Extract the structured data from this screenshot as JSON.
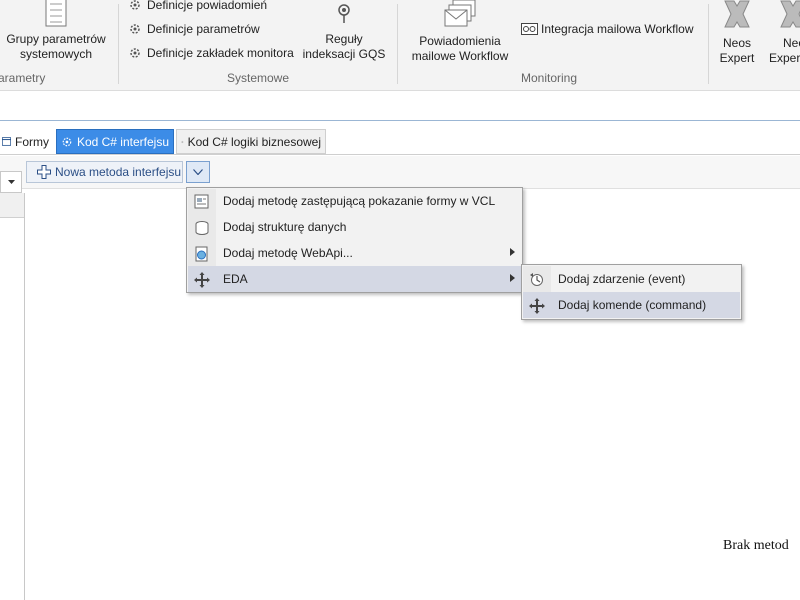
{
  "ribbon": {
    "group_parametry": {
      "button_label_line1": "Grupy parametrów",
      "button_label_line2": "systemowych",
      "group_label": "arametry"
    },
    "group_systemowe": {
      "items": [
        {
          "label": "Definicje powiadomień"
        },
        {
          "label": "Definicje parametrów"
        },
        {
          "label": "Definicje zakładek monitora"
        }
      ],
      "reguly_line1": "Reguły",
      "reguly_line2": "indeksacji GQS",
      "group_label": "Systemowe"
    },
    "group_monitoring": {
      "powiadomienia_line1": "Powiadomienia",
      "powiadomienia_line2": "mailowe Workflow",
      "integracja_label": "Integracja  mailowa Workflow",
      "group_label": "Monitoring"
    },
    "neos1_line1": "Neos",
    "neos1_line2": "Expert",
    "neos2_line1": "Neo",
    "neos2_line2": "Expert"
  },
  "tabs": [
    {
      "label": "Formy"
    },
    {
      "label": "Kod C# interfejsu",
      "active": true
    },
    {
      "label": "Kod C# logiki biznesowej"
    }
  ],
  "toolbar": {
    "new_method_label": "Nowa metoda interfejsu"
  },
  "menu": {
    "items": [
      {
        "label": "Dodaj metodę zastępującą pokazanie formy w VCL",
        "icon": "form-code-icon"
      },
      {
        "label": "Dodaj strukturę danych",
        "icon": "struct-icon"
      },
      {
        "label": "Dodaj metodę WebApi...",
        "icon": "webapi-icon",
        "submenu": true
      },
      {
        "label": "EDA",
        "icon": "eda-icon",
        "submenu": true,
        "highlighted": true
      }
    ]
  },
  "submenu": {
    "items": [
      {
        "label": "Dodaj zdarzenie (event)",
        "icon": "event-icon"
      },
      {
        "label": "Dodaj komende (command)",
        "icon": "command-icon",
        "highlighted": true
      }
    ]
  },
  "status_text": "Brak metod",
  "colors": {
    "tab_active_bg": "#3c8ce7",
    "menu_highlight": "#d4d8e4",
    "link_blue": "#2b4f86"
  }
}
